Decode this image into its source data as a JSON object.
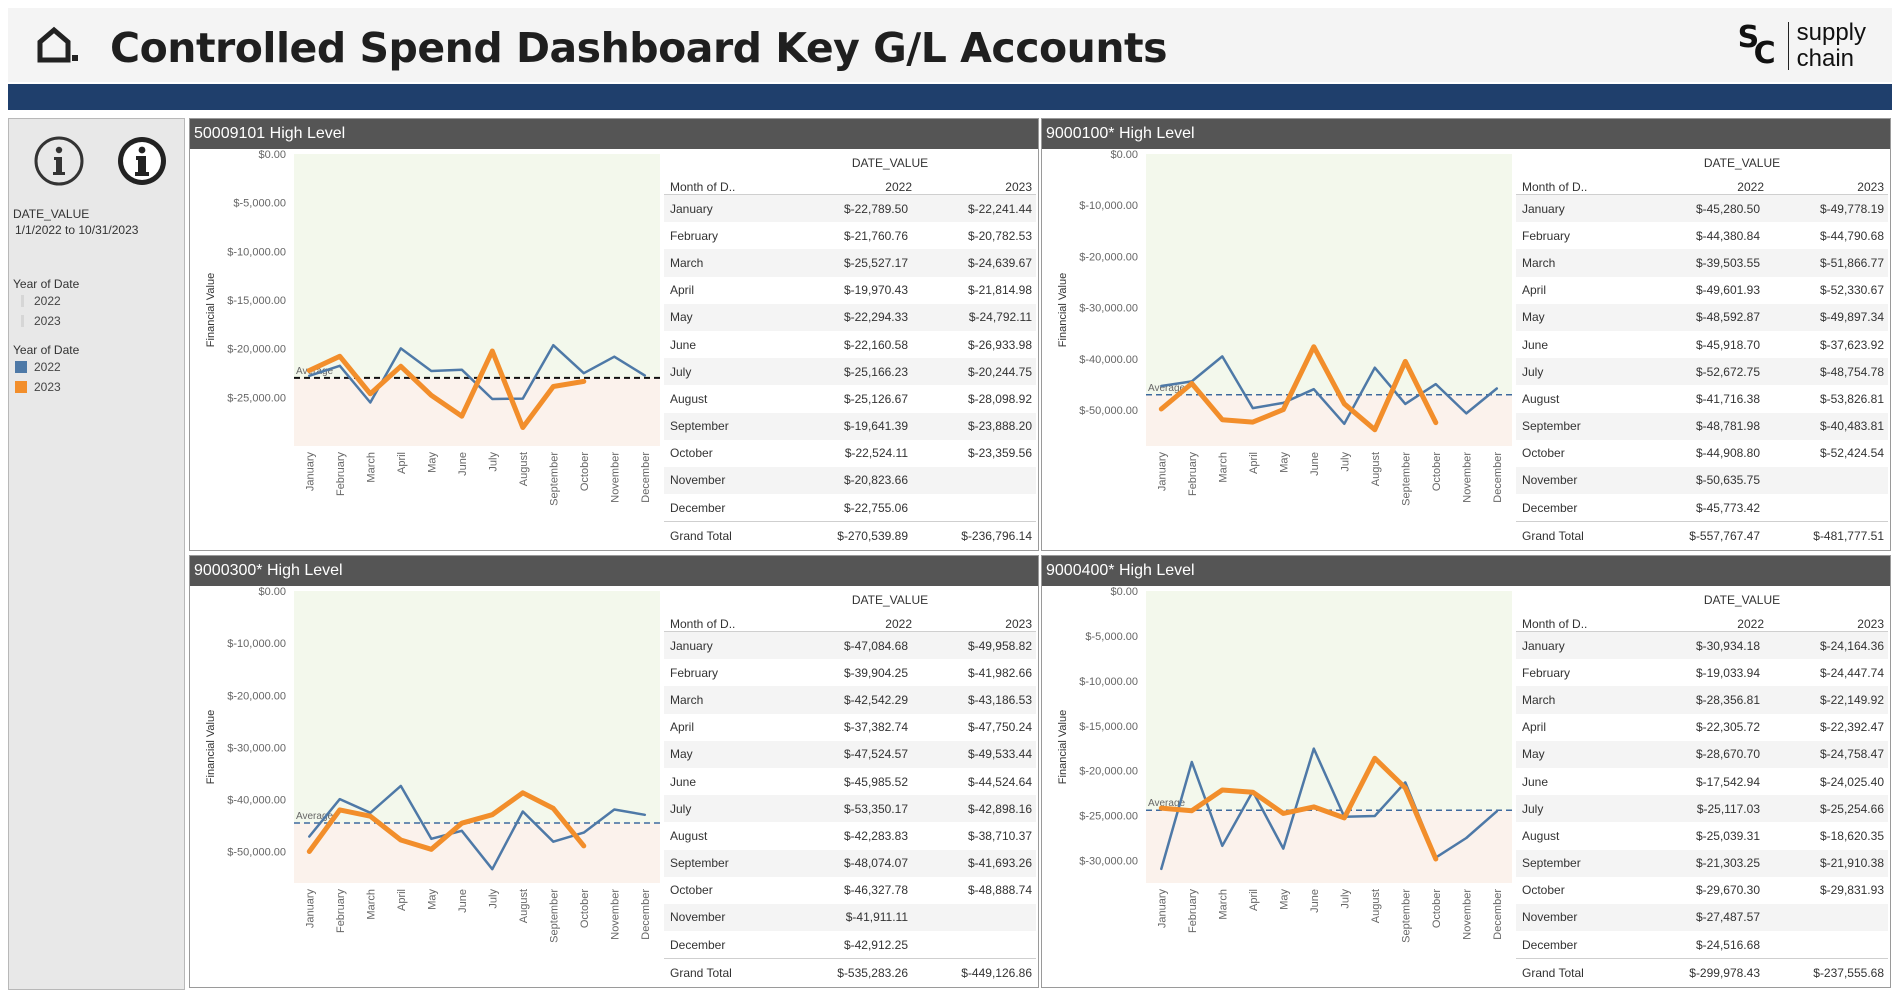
{
  "page": {
    "title": "Controlled Spend Dashboard Key G/L Accounts",
    "logo_text_line1": "supply",
    "logo_text_line2": "chain",
    "logo_mark_s": "S",
    "logo_mark_c": "C"
  },
  "sidebar": {
    "date_label": "DATE_VALUE",
    "date_range": "1/1/2022 to 10/31/2023",
    "year_filter_title": "Year of Date",
    "year_filter_items": [
      "2022",
      "2023"
    ],
    "year_legend_title": "Year of Date",
    "year_legend_items": [
      {
        "label": "2022",
        "color": "#4e79a7"
      },
      {
        "label": "2023",
        "color": "#f28e2b"
      }
    ]
  },
  "common": {
    "y_axis_label": "Financial Value",
    "average_label": "Average",
    "table_header_group": "DATE_VALUE",
    "table_month_header": "Month of D..",
    "table_year_headers": [
      "2022",
      "2023"
    ],
    "grand_total_label": "Grand Total",
    "months": [
      "January",
      "February",
      "March",
      "April",
      "May",
      "June",
      "July",
      "August",
      "September",
      "October",
      "November",
      "December"
    ]
  },
  "panels": [
    {
      "title": "50009101 High Level",
      "table_rows": [
        [
          "January",
          "$-22,789.50",
          "$-22,241.44"
        ],
        [
          "February",
          "$-21,760.76",
          "$-20,782.53"
        ],
        [
          "March",
          "$-25,527.17",
          "$-24,639.67"
        ],
        [
          "April",
          "$-19,970.43",
          "$-21,814.98"
        ],
        [
          "May",
          "$-22,294.33",
          "$-24,792.11"
        ],
        [
          "June",
          "$-22,160.58",
          "$-26,933.98"
        ],
        [
          "July",
          "$-25,166.23",
          "$-20,244.75"
        ],
        [
          "August",
          "$-25,126.67",
          "$-28,098.92"
        ],
        [
          "September",
          "$-19,641.39",
          "$-23,888.20"
        ],
        [
          "October",
          "$-22,524.11",
          "$-23,359.56"
        ],
        [
          "November",
          "$-20,823.66",
          ""
        ],
        [
          "December",
          "$-22,755.06",
          ""
        ]
      ],
      "grand_total": [
        "$-270,539.89",
        "$-236,796.14"
      ],
      "chart_data": {
        "type": "line",
        "categories": [
          "January",
          "February",
          "March",
          "April",
          "May",
          "June",
          "July",
          "August",
          "September",
          "October",
          "November",
          "December"
        ],
        "series": [
          {
            "name": "2022",
            "color": "#4e79a7",
            "values": [
              -22789.5,
              -21760.76,
              -25527.17,
              -19970.43,
              -22294.33,
              -22160.58,
              -25166.23,
              -25126.67,
              -19641.39,
              -22524.11,
              -20823.66,
              -22755.06
            ]
          },
          {
            "name": "2023",
            "color": "#f28e2b",
            "values": [
              -22241.44,
              -20782.53,
              -24639.67,
              -21814.98,
              -24792.11,
              -26933.98,
              -20244.75,
              -28098.92,
              -23888.2,
              -23359.56,
              null,
              null
            ]
          }
        ],
        "ylim": [
          -30000,
          0
        ],
        "yticks": [
          0,
          -5000,
          -10000,
          -15000,
          -20000,
          -25000
        ],
        "ytick_labels": [
          "$0.00",
          "$-5,000.00",
          "$-10,000.00",
          "$-15,000.00",
          "$-20,000.00",
          "$-25,000.00"
        ],
        "average": -23000,
        "average_color": "#111111",
        "ylabel": "Financial Value"
      }
    },
    {
      "title": "9000100* High Level",
      "table_rows": [
        [
          "January",
          "$-45,280.50",
          "$-49,778.19"
        ],
        [
          "February",
          "$-44,380.84",
          "$-44,790.68"
        ],
        [
          "March",
          "$-39,503.55",
          "$-51,866.77"
        ],
        [
          "April",
          "$-49,601.93",
          "$-52,330.67"
        ],
        [
          "May",
          "$-48,592.87",
          "$-49,897.34"
        ],
        [
          "June",
          "$-45,918.70",
          "$-37,623.92"
        ],
        [
          "July",
          "$-52,672.75",
          "$-48,754.78"
        ],
        [
          "August",
          "$-41,716.38",
          "$-53,826.81"
        ],
        [
          "September",
          "$-48,781.98",
          "$-40,483.81"
        ],
        [
          "October",
          "$-44,908.80",
          "$-52,424.54"
        ],
        [
          "November",
          "$-50,635.75",
          ""
        ],
        [
          "December",
          "$-45,773.42",
          ""
        ]
      ],
      "grand_total": [
        "$-557,767.47",
        "$-481,777.51"
      ],
      "chart_data": {
        "type": "line",
        "categories": [
          "January",
          "February",
          "March",
          "April",
          "May",
          "June",
          "July",
          "August",
          "September",
          "October",
          "November",
          "December"
        ],
        "series": [
          {
            "name": "2022",
            "color": "#4e79a7",
            "values": [
              -45280.5,
              -44380.84,
              -39503.55,
              -49601.93,
              -48592.87,
              -45918.7,
              -52672.75,
              -41716.38,
              -48781.98,
              -44908.8,
              -50635.75,
              -45773.42
            ]
          },
          {
            "name": "2023",
            "color": "#f28e2b",
            "values": [
              -49778.19,
              -44790.68,
              -51866.77,
              -52330.67,
              -49897.34,
              -37623.92,
              -48754.78,
              -53826.81,
              -40483.81,
              -52424.54,
              null,
              null
            ]
          }
        ],
        "ylim": [
          -57000,
          0
        ],
        "yticks": [
          0,
          -10000,
          -20000,
          -30000,
          -40000,
          -50000
        ],
        "ytick_labels": [
          "$0.00",
          "$-10,000.00",
          "$-20,000.00",
          "$-30,000.00",
          "$-40,000.00",
          "$-50,000.00"
        ],
        "average": -47000,
        "average_color": "#3e6a9e",
        "ylabel": "Financial Value"
      }
    },
    {
      "title": "9000300* High Level",
      "table_rows": [
        [
          "January",
          "$-47,084.68",
          "$-49,958.82"
        ],
        [
          "February",
          "$-39,904.25",
          "$-41,982.66"
        ],
        [
          "March",
          "$-42,542.29",
          "$-43,186.53"
        ],
        [
          "April",
          "$-37,382.74",
          "$-47,750.24"
        ],
        [
          "May",
          "$-47,524.57",
          "$-49,533.44"
        ],
        [
          "June",
          "$-45,985.52",
          "$-44,524.64"
        ],
        [
          "July",
          "$-53,350.17",
          "$-42,898.16"
        ],
        [
          "August",
          "$-42,283.83",
          "$-38,710.37"
        ],
        [
          "September",
          "$-48,074.07",
          "$-41,693.26"
        ],
        [
          "October",
          "$-46,327.78",
          "$-48,888.74"
        ],
        [
          "November",
          "$-41,911.11",
          ""
        ],
        [
          "December",
          "$-42,912.25",
          ""
        ]
      ],
      "grand_total": [
        "$-535,283.26",
        "$-449,126.86"
      ],
      "chart_data": {
        "type": "line",
        "categories": [
          "January",
          "February",
          "March",
          "April",
          "May",
          "June",
          "July",
          "August",
          "September",
          "October",
          "November",
          "December"
        ],
        "series": [
          {
            "name": "2022",
            "color": "#4e79a7",
            "values": [
              -47084.68,
              -39904.25,
              -42542.29,
              -37382.74,
              -47524.57,
              -45985.52,
              -53350.17,
              -42283.83,
              -48074.07,
              -46327.78,
              -41911.11,
              -42912.25
            ]
          },
          {
            "name": "2023",
            "color": "#f28e2b",
            "values": [
              -49958.82,
              -41982.66,
              -43186.53,
              -47750.24,
              -49533.44,
              -44524.64,
              -42898.16,
              -38710.37,
              -41693.26,
              -48888.74,
              null,
              null
            ]
          }
        ],
        "ylim": [
          -56000,
          0
        ],
        "yticks": [
          0,
          -10000,
          -20000,
          -30000,
          -40000,
          -50000
        ],
        "ytick_labels": [
          "$0.00",
          "$-10,000.00",
          "$-20,000.00",
          "$-30,000.00",
          "$-40,000.00",
          "$-50,000.00"
        ],
        "average": -44500,
        "average_color": "#3e6a9e",
        "ylabel": "Financial Value"
      }
    },
    {
      "title": "9000400* High Level",
      "table_rows": [
        [
          "January",
          "$-30,934.18",
          "$-24,164.36"
        ],
        [
          "February",
          "$-19,033.94",
          "$-24,447.74"
        ],
        [
          "March",
          "$-28,356.81",
          "$-22,149.92"
        ],
        [
          "April",
          "$-22,305.72",
          "$-22,392.47"
        ],
        [
          "May",
          "$-28,670.70",
          "$-24,758.47"
        ],
        [
          "June",
          "$-17,542.94",
          "$-24,025.40"
        ],
        [
          "July",
          "$-25,117.03",
          "$-25,254.66"
        ],
        [
          "August",
          "$-25,039.31",
          "$-18,620.35"
        ],
        [
          "September",
          "$-21,303.25",
          "$-21,910.38"
        ],
        [
          "October",
          "$-29,670.30",
          "$-29,831.93"
        ],
        [
          "November",
          "$-27,487.57",
          ""
        ],
        [
          "December",
          "$-24,516.68",
          ""
        ]
      ],
      "grand_total": [
        "$-299,978.43",
        "$-237,555.68"
      ],
      "chart_data": {
        "type": "line",
        "categories": [
          "January",
          "February",
          "March",
          "April",
          "May",
          "June",
          "July",
          "August",
          "September",
          "October",
          "November",
          "December"
        ],
        "series": [
          {
            "name": "2022",
            "color": "#4e79a7",
            "values": [
              -30934.18,
              -19033.94,
              -28356.81,
              -22305.72,
              -28670.7,
              -17542.94,
              -25117.03,
              -25039.31,
              -21303.25,
              -29670.3,
              -27487.57,
              -24516.68
            ]
          },
          {
            "name": "2023",
            "color": "#f28e2b",
            "values": [
              -24164.36,
              -24447.74,
              -22149.92,
              -22392.47,
              -24758.47,
              -24025.4,
              -25254.66,
              -18620.35,
              -21910.38,
              -29831.93,
              null,
              null
            ]
          }
        ],
        "ylim": [
          -32500,
          0
        ],
        "yticks": [
          0,
          -5000,
          -10000,
          -15000,
          -20000,
          -25000,
          -30000
        ],
        "ytick_labels": [
          "$0.00",
          "$-5,000.00",
          "$-10,000.00",
          "$-15,000.00",
          "$-20,000.00",
          "$-25,000.00",
          "$-30,000.00"
        ],
        "average": -24400,
        "average_color": "#3e6a9e",
        "ylabel": "Financial Value"
      }
    }
  ]
}
